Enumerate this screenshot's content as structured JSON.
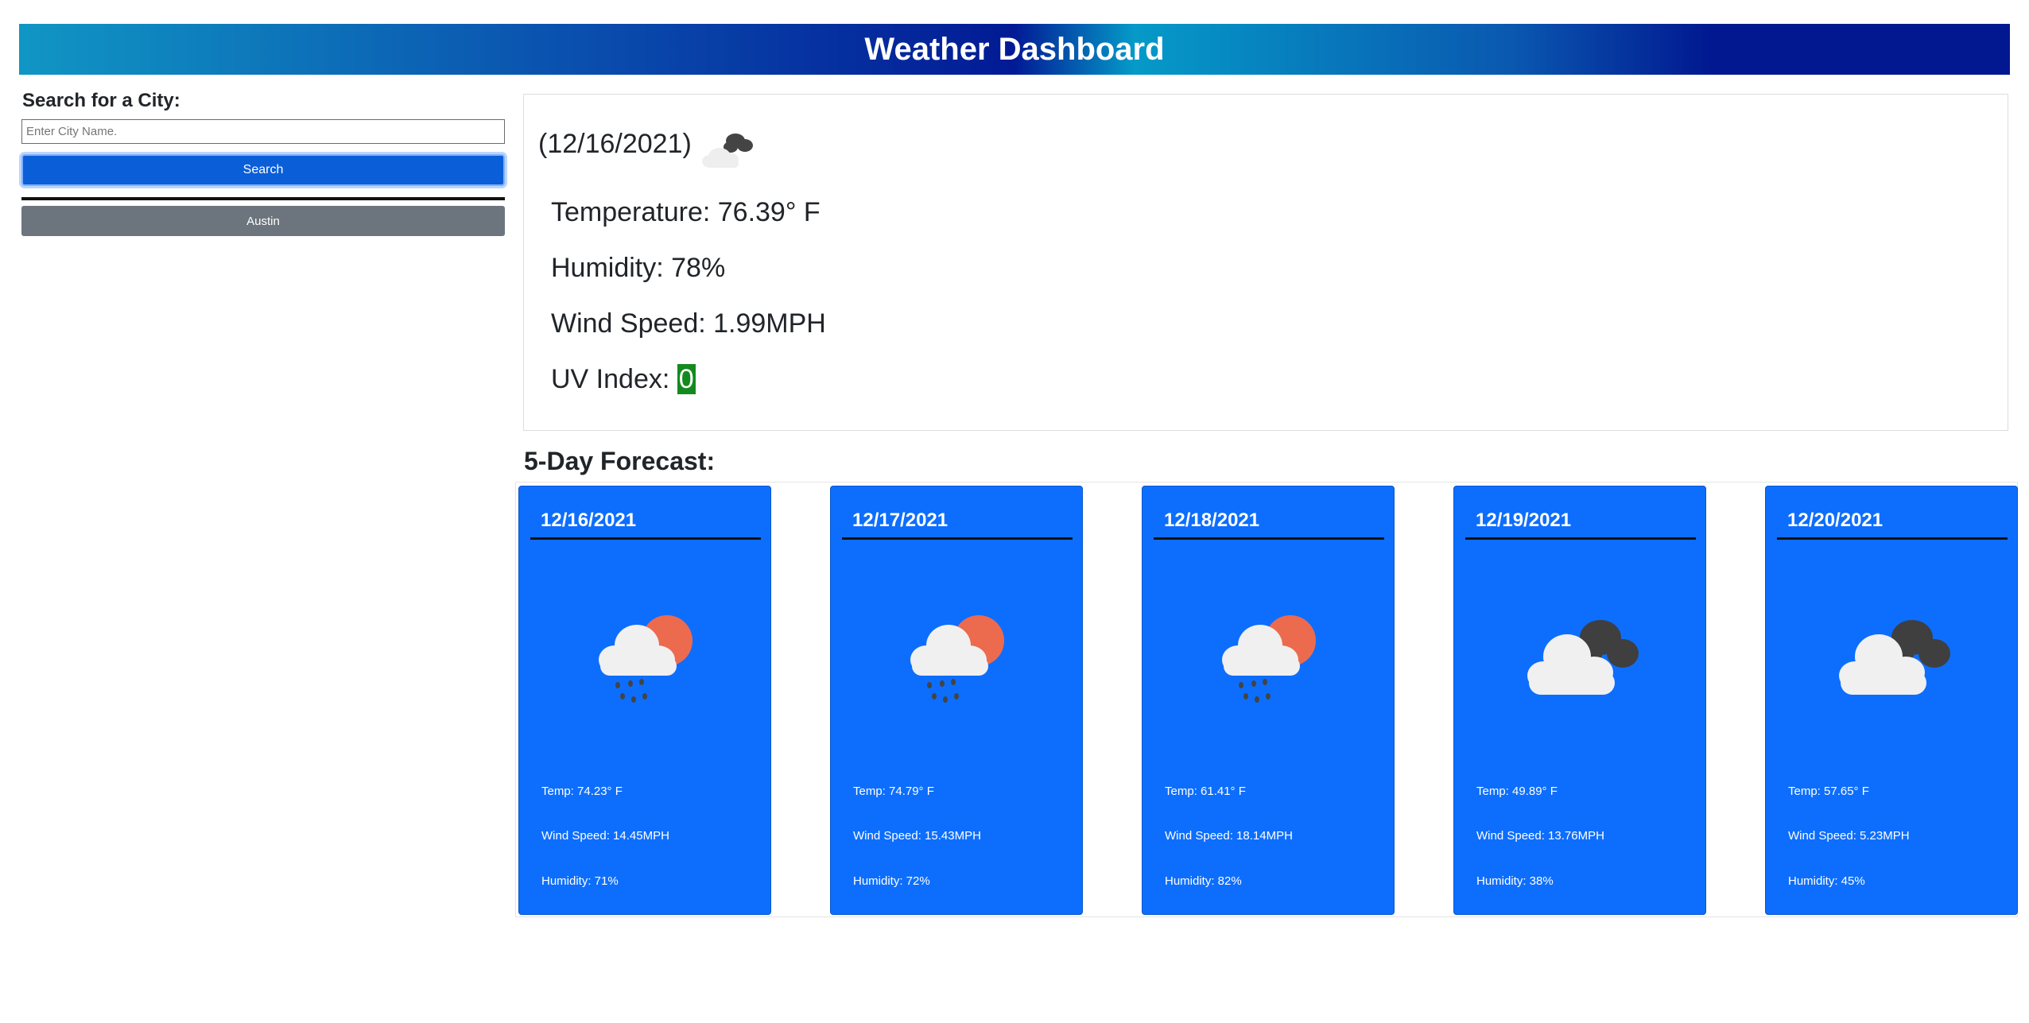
{
  "header": {
    "title": "Weather Dashboard"
  },
  "search": {
    "label": "Search for a City:",
    "placeholder": "Enter City Name.",
    "button_label": "Search"
  },
  "history": {
    "items": [
      {
        "label": "Austin"
      }
    ]
  },
  "current": {
    "date": "(12/16/2021)",
    "icon": "broken-clouds-icon",
    "temperature": "Temperature: 76.39° F",
    "humidity": "Humidity: 78%",
    "wind": "Wind Speed: 1.99MPH",
    "uv_label": "UV Index: ",
    "uv_value": "0",
    "uv_color": "#138a1e"
  },
  "forecast": {
    "heading": "5-Day Forecast:",
    "card_color": "#0d6efd",
    "days": [
      {
        "date": "12/16/2021",
        "icon": "rain-sun-icon",
        "temp": "Temp: 74.23° F",
        "wind": "Wind Speed: 14.45MPH",
        "humidity": "Humidity: 71%"
      },
      {
        "date": "12/17/2021",
        "icon": "rain-sun-icon",
        "temp": "Temp: 74.79° F",
        "wind": "Wind Speed: 15.43MPH",
        "humidity": "Humidity: 72%"
      },
      {
        "date": "12/18/2021",
        "icon": "rain-sun-icon",
        "temp": "Temp: 61.41° F",
        "wind": "Wind Speed: 18.14MPH",
        "humidity": "Humidity: 82%"
      },
      {
        "date": "12/19/2021",
        "icon": "broken-clouds-icon",
        "temp": "Temp: 49.89° F",
        "wind": "Wind Speed: 13.76MPH",
        "humidity": "Humidity: 38%"
      },
      {
        "date": "12/20/2021",
        "icon": "broken-clouds-icon",
        "temp": "Temp: 57.65° F",
        "wind": "Wind Speed: 5.23MPH",
        "humidity": "Humidity: 45%"
      }
    ]
  }
}
